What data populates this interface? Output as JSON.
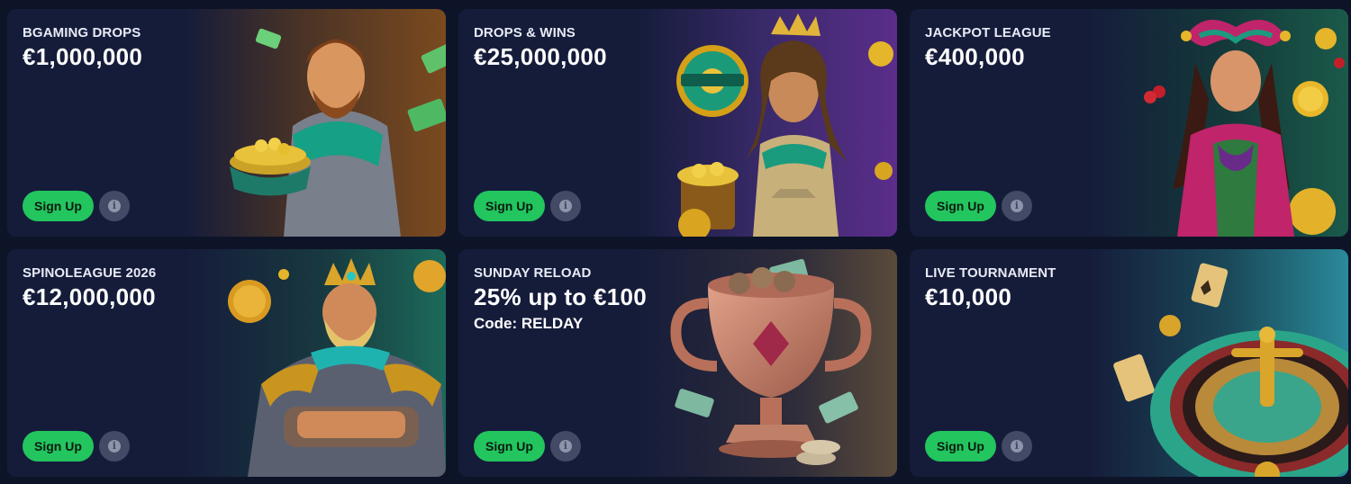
{
  "buttons": {
    "signup_label": "Sign Up",
    "info_glyph": "i"
  },
  "colors": {
    "page_bg": "#0e1428",
    "card_bg": "#151c3a",
    "signup_bg": "#22c55e",
    "info_bg": "#434a66"
  },
  "promotions": [
    {
      "label": "BGAMING DROPS",
      "amount": "€1,000,000",
      "code": "",
      "art": "bearded-warrior-with-gold-bowl"
    },
    {
      "label": "DROPS & WINS",
      "amount": "€25,000,000",
      "code": "",
      "art": "genie-woman-with-drops-wins-wheel"
    },
    {
      "label": "JACKPOT LEAGUE",
      "amount": "€400,000",
      "code": "",
      "art": "jester-woman-with-gold-coin"
    },
    {
      "label": "SPINOLEAGUE 2026",
      "amount": "€12,000,000",
      "code": "",
      "art": "crowned-king-warrior"
    },
    {
      "label": "SUNDAY RELOAD",
      "amount": "25% up to €100",
      "code": "Code: RELDAY",
      "art": "bronze-trophy-with-coins"
    },
    {
      "label": "LIVE TOURNAMENT",
      "amount": "€10,000",
      "code": "",
      "art": "roulette-wheel-with-cards"
    }
  ]
}
